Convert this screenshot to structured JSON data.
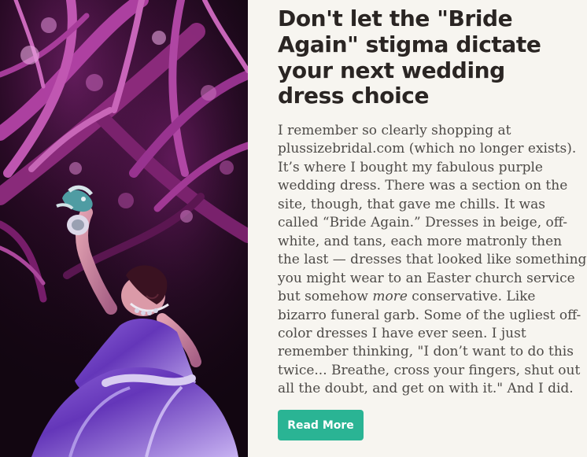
{
  "article": {
    "title": "Don't let the \"Bride Again\" stigma dictate your next wedding dress choice",
    "body_lines": [
      "I remember so clearly shopping at",
      "plussizebridal.com (which no longer exists).",
      "It’s where I bought my fabulous purple",
      "wedding dress. There was a section on the",
      "site, though, that gave me chills. It was",
      "called “Bride Again.” Dresses in beige, off-",
      "white, and tans, each more matronly then",
      "the last — dresses that looked like something",
      "you might wear to an Easter church service",
      {
        "before": "but somehow ",
        "emphasis": "more",
        "after": " conservative. Like"
      },
      "bizarro funeral garb. Some of the ugliest off-",
      "color dresses I have ever seen. I just",
      "remember thinking, \"I don’t want to do this",
      "twice... Breathe, cross your fingers, shut out",
      "all the doubt, and get on with it.\" And I did."
    ],
    "cta_label": "Read More",
    "accent_color": "#2ab494"
  }
}
